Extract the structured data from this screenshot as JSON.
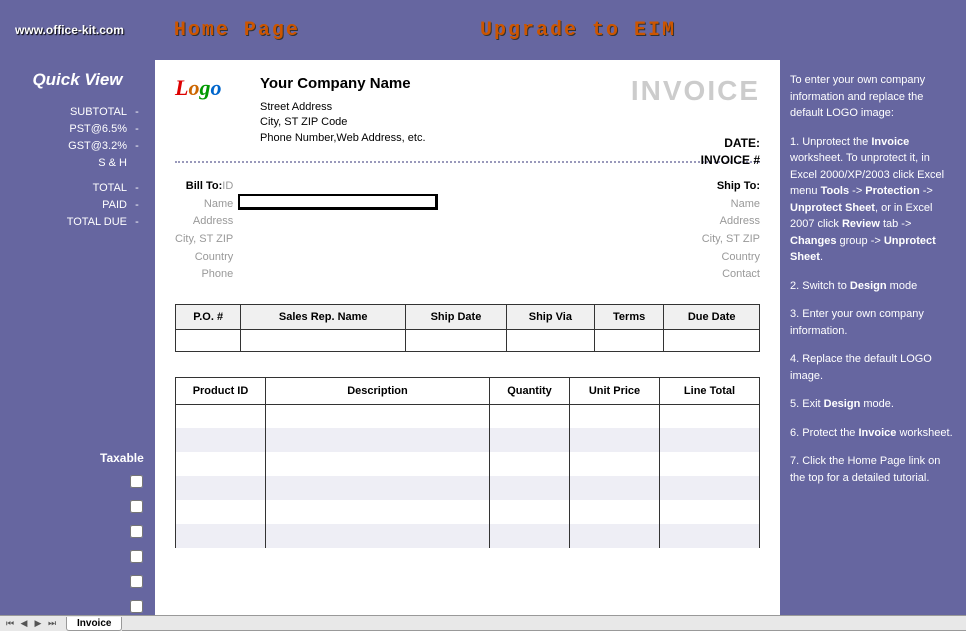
{
  "header": {
    "url": "www.office-kit.com",
    "home_link": "Home Page",
    "upgrade_link": "Upgrade to EIM"
  },
  "quick_view": {
    "title": "Quick View",
    "rows": [
      {
        "label": "SUBTOTAL",
        "value": "-"
      },
      {
        "label": "PST@6.5%",
        "value": "-"
      },
      {
        "label": "GST@3.2%",
        "value": "-"
      },
      {
        "label": "S & H",
        "value": ""
      },
      {
        "label": "",
        "value": ""
      },
      {
        "label": "TOTAL",
        "value": "-"
      },
      {
        "label": "PAID",
        "value": "-"
      },
      {
        "label": "TOTAL DUE",
        "value": "-"
      }
    ],
    "taxable_label": "Taxable"
  },
  "company": {
    "name": "Your Company Name",
    "street": "Street Address",
    "city_line": "City, ST  ZIP Code",
    "contact_line": "Phone Number,Web Address, etc."
  },
  "invoice": {
    "title": "INVOICE",
    "date_label": "DATE:",
    "number_label": "INVOICE #"
  },
  "bill_to": {
    "header": "Bill To:",
    "labels": [
      "ID",
      "Name",
      "Address",
      "City, ST ZIP",
      "Country",
      "Phone"
    ]
  },
  "ship_to": {
    "header": "Ship To:",
    "labels": [
      "Name",
      "Address",
      "City, ST ZIP",
      "Country",
      "Contact"
    ]
  },
  "po_headers": [
    "P.O. #",
    "Sales Rep. Name",
    "Ship Date",
    "Ship Via",
    "Terms",
    "Due Date"
  ],
  "items_headers": [
    "Product ID",
    "Description",
    "Quantity",
    "Unit Price",
    "Line Total"
  ],
  "instructions": {
    "intro": "To enter your own company information and replace the default LOGO image:",
    "s1a": "1. Unprotect the ",
    "s1b": "Invoice",
    "s1c": " worksheet. To unprotect it, in Excel 2000/XP/2003 click Excel menu ",
    "s1d": "Tools",
    "s1e": " -> ",
    "s1f": "Protection",
    "s1g": " -> ",
    "s1h": "Unprotect Sheet",
    "s1i": ", or in Excel 2007 click ",
    "s1j": "Review",
    "s1k": " tab -> ",
    "s1l": "Changes",
    "s1m": " group -> ",
    "s1n": "Unprotect Sheet",
    "s1o": ".",
    "s2a": "2. Switch to ",
    "s2b": "Design",
    "s2c": " mode",
    "s3": "3. Enter your own company information.",
    "s4": "4. Replace the default LOGO image.",
    "s5a": "5. Exit ",
    "s5b": "Design",
    "s5c": " mode.",
    "s6a": "6. Protect the ",
    "s6b": "Invoice",
    "s6c": " worksheet.",
    "s7": "7. Click the Home Page link on the top for a detailed tutorial."
  },
  "tabs": {
    "sheet1": "Invoice"
  }
}
